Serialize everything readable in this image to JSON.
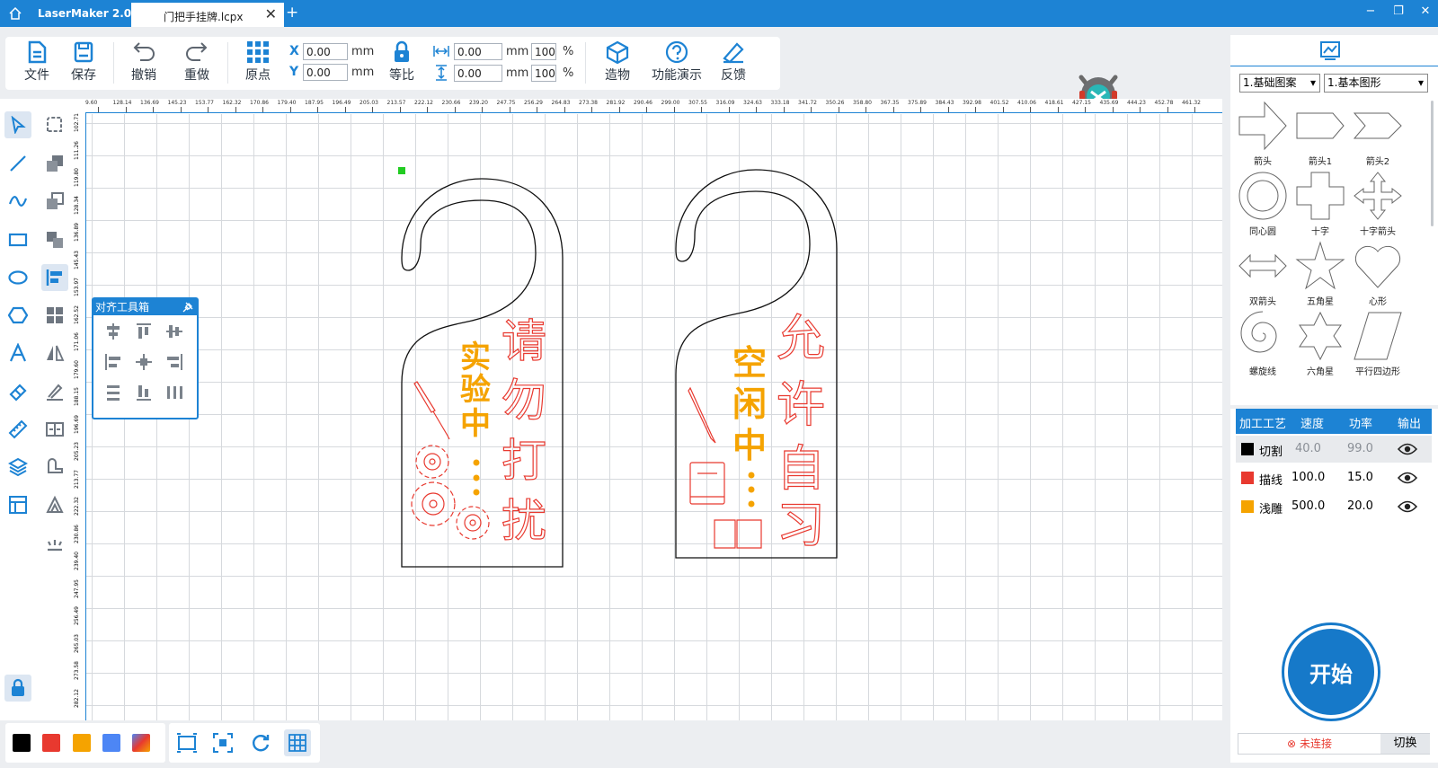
{
  "titlebar": {
    "app_name": "LaserMaker 2.0.10",
    "doc_tab": "门把手挂牌.lcpx",
    "close_tab": "✕",
    "new_tab": "+",
    "win_min": "−",
    "win_max": "❐",
    "win_close": "✕"
  },
  "toolbar": {
    "file": "文件",
    "save": "保存",
    "undo": "撤销",
    "redo": "重做",
    "origin": "原点",
    "x_label": "X",
    "y_label": "Y",
    "x_value": "0.00",
    "y_value": "0.00",
    "unit_mm": "mm",
    "lock_ratio": "等比",
    "width_value": "0.00",
    "height_value": "0.00",
    "width_pct": "100",
    "height_pct": "100",
    "percent": "%",
    "build": "造物",
    "demo": "功能演示",
    "feedback": "反馈"
  },
  "ruler": {
    "h_ticks": [
      "9.60",
      "128.14",
      "136.69",
      "145.23",
      "153.77",
      "162.32",
      "170.86",
      "179.40",
      "187.95",
      "196.49",
      "205.03",
      "213.57",
      "222.12",
      "230.66",
      "239.20",
      "247.75",
      "256.29",
      "264.83",
      "273.38",
      "281.92",
      "290.46",
      "299.00",
      "307.55",
      "316.09",
      "324.63",
      "333.18",
      "341.72",
      "350.26",
      "358.80",
      "367.35",
      "375.89",
      "384.43",
      "392.98",
      "401.52",
      "410.06",
      "418.61",
      "427.15",
      "435.69",
      "444.23",
      "452.78",
      "461.32"
    ],
    "v_ticks": [
      "102.71",
      "111.26",
      "119.80",
      "128.34",
      "136.89",
      "145.43",
      "153.97",
      "162.52",
      "171.06",
      "179.60",
      "188.15",
      "196.69",
      "205.23",
      "213.77",
      "222.32",
      "230.86",
      "239.40",
      "247.95",
      "256.49",
      "265.03",
      "273.58",
      "282.12"
    ]
  },
  "align_box": {
    "title": "对齐工具箱"
  },
  "hangers": {
    "left": {
      "big_text": [
        "请",
        "勿",
        "打",
        "扰"
      ],
      "small_text": [
        "实",
        "验",
        "中"
      ]
    },
    "right": {
      "big_text": [
        "允",
        "许",
        "自",
        "习"
      ],
      "small_text": [
        "空",
        "闲",
        "中"
      ]
    }
  },
  "colors": {
    "accent": "#1d83d4",
    "cut": "#000000",
    "line": "#e8392f",
    "engrave": "#f5a300",
    "blue": "#4d86f5"
  },
  "shapes_panel": {
    "category": "1.基础图案",
    "subcategory": "1.基本图形",
    "dropdown_arrow": "▾",
    "items": [
      {
        "label": "箭头"
      },
      {
        "label": "箭头1"
      },
      {
        "label": "箭头2"
      },
      {
        "label": "同心圆"
      },
      {
        "label": "十字"
      },
      {
        "label": "十字箭头"
      },
      {
        "label": "双箭头"
      },
      {
        "label": "五角星"
      },
      {
        "label": "心形"
      },
      {
        "label": "螺旋线"
      },
      {
        "label": "六角星"
      },
      {
        "label": "平行四边形"
      }
    ]
  },
  "layers": {
    "headers": [
      "加工工艺",
      "速度",
      "功率",
      "输出"
    ],
    "rows": [
      {
        "name": "切割",
        "speed": "40.0",
        "power": "99.0",
        "color": "#000000"
      },
      {
        "name": "描线",
        "speed": "100.0",
        "power": "15.0",
        "color": "#e8392f"
      },
      {
        "name": "浅雕",
        "speed": "500.0",
        "power": "20.0",
        "color": "#f5a300"
      }
    ]
  },
  "start_button": "开始",
  "connection": {
    "status": "未连接",
    "switch": "切换",
    "status_icon": "⊗"
  }
}
